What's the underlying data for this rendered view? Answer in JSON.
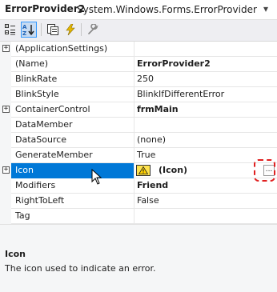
{
  "header": {
    "component_name": "ErrorProvider2",
    "component_type": "System.Windows.Forms.ErrorProvider",
    "dropdown_icon": "chevron-down-icon"
  },
  "toolbar": {
    "buttons": [
      {
        "name": "categorized-icon"
      },
      {
        "name": "alphabetical-icon",
        "active": true
      },
      {
        "name": "properties-icon"
      },
      {
        "name": "events-icon"
      },
      {
        "name": "property-pages-icon"
      }
    ]
  },
  "properties": [
    {
      "name": "(ApplicationSettings)",
      "value": "",
      "expandable": true
    },
    {
      "name": "(Name)",
      "value": "ErrorProvider2",
      "bold": true
    },
    {
      "name": "BlinkRate",
      "value": "250"
    },
    {
      "name": "BlinkStyle",
      "value": "BlinkIfDifferentError"
    },
    {
      "name": "ContainerControl",
      "value": "frmMain",
      "bold": true,
      "expandable": true
    },
    {
      "name": "DataMember",
      "value": ""
    },
    {
      "name": "DataSource",
      "value": "(none)"
    },
    {
      "name": "GenerateMember",
      "value": "True"
    },
    {
      "name": "Icon",
      "value": "(Icon)",
      "bold": true,
      "expandable": true,
      "selected": true,
      "value_icon": "warning-icon",
      "button": "..."
    },
    {
      "name": "Modifiers",
      "value": "Friend",
      "bold": true
    },
    {
      "name": "RightToLeft",
      "value": "False"
    },
    {
      "name": "Tag",
      "value": ""
    }
  ],
  "description": {
    "title": "Icon",
    "text": "The icon used to indicate an error."
  },
  "colors": {
    "selection": "#0078d7",
    "highlight_annotation": "#e02020",
    "warning_icon": "#ffe34d"
  }
}
